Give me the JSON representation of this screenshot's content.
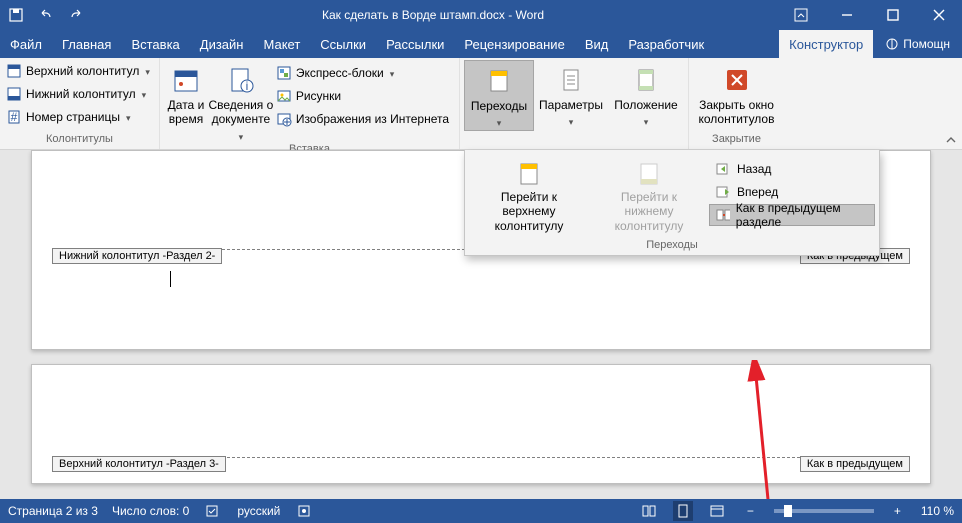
{
  "titlebar": {
    "title": "Как сделать в Ворде штамп.docx - Word"
  },
  "tabs": {
    "file": "Файл",
    "home": "Главная",
    "insert": "Вставка",
    "design": "Дизайн",
    "layout": "Макет",
    "references": "Ссылки",
    "mailings": "Рассылки",
    "review": "Рецензирование",
    "view": "Вид",
    "developer": "Разработчик",
    "designer": "Конструктор",
    "help": "Помощн"
  },
  "ribbon": {
    "hf": {
      "header": "Верхний колонтитул",
      "footer": "Нижний колонтитул",
      "page_num": "Номер страницы",
      "group": "Колонтитулы"
    },
    "insert": {
      "datetime": "Дата и время",
      "docinfo": "Сведения о документе",
      "quickparts": "Экспресс-блоки",
      "pictures": "Рисунки",
      "online_pics": "Изображения из Интернета",
      "group": "Вставка"
    },
    "nav": {
      "goto": "Переходы",
      "options": "Параметры",
      "position": "Положение"
    },
    "close": {
      "label": "Закрыть окно колонтитулов",
      "group": "Закрытие"
    }
  },
  "dropdown": {
    "goto_header": "Перейти к верхнему колонтитулу",
    "goto_footer": "Перейти к нижнему колонтитулу",
    "back": "Назад",
    "forward": "Вперед",
    "link_prev": "Как в предыдущем разделе",
    "group": "Переходы"
  },
  "doc": {
    "footer_tag": "Нижний колонтитул -Раздел 2-",
    "header_tag": "Верхний колонтитул -Раздел 3-",
    "same_prev": "Как в предыдущем"
  },
  "status": {
    "page": "Страница 2 из 3",
    "words": "Число слов: 0",
    "lang": "русский",
    "zoom": "110 %"
  }
}
